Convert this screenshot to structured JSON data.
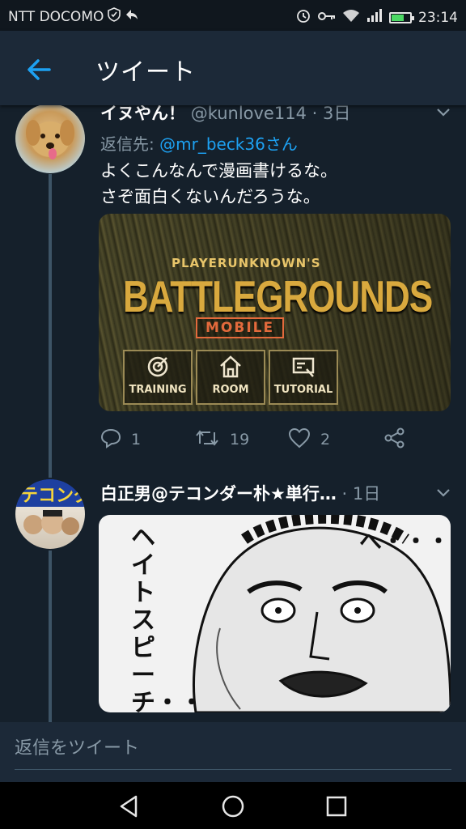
{
  "status_bar": {
    "carrier": "NTT DOCOMO",
    "time": "23:14",
    "icons": [
      "shield-icon",
      "back-arrow-notify-icon",
      "alarm-icon",
      "key-icon",
      "wifi-icon",
      "signal-icon",
      "battery-icon"
    ]
  },
  "app_bar": {
    "title": "ツイート",
    "back_icon": "arrow-left-icon"
  },
  "tweets": [
    {
      "name": "イヌやん！",
      "handle": "@kunlove114",
      "time": " · 3日",
      "replying_label": "返信先: ",
      "replying_to": "@mr_beck36さん",
      "text_line1": "よくこんなんで漫画書けるな。",
      "text_line2": "さぞ面白くないんだろうな。",
      "media": {
        "small_title": "PLAYERUNKNOWN'S",
        "big_title": "BATTLEGROUNDS",
        "badge": "MOBILE",
        "buttons": [
          "TRAINING",
          "ROOM",
          "TUTORIAL"
        ]
      },
      "actions": {
        "reply_count": "1",
        "retweet_count": "19",
        "like_count": "2"
      }
    },
    {
      "name": "白正男@テコンダー朴★単行…",
      "time": " · 1日",
      "media": {
        "vertical_text": "ヘイトスピーチ・・",
        "dots": "へ・・・"
      }
    }
  ],
  "reply_bar": {
    "placeholder": "返信をツイート"
  },
  "colors": {
    "background": "#15202b",
    "accent": "#1da1f2",
    "muted": "#8899a6"
  }
}
